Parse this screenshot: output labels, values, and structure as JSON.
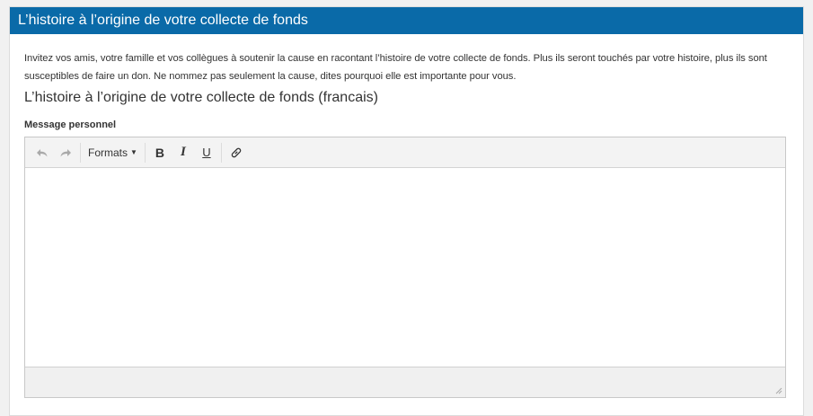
{
  "panel": {
    "title": "L’histoire à l’origine de votre collecte de fonds",
    "intro": "Invitez vos amis, votre famille et vos collègues à soutenir la cause en racontant l’histoire de votre collecte de fonds. Plus ils seront touchés par votre histoire, plus ils sont susceptibles de faire un don. Ne nommez pas seulement la cause, dites pourquoi elle est importante pour vous.",
    "section_title": "L’histoire à l’origine de votre collecte de fonds (francais)",
    "field_label": "Message personnel"
  },
  "editor": {
    "toolbar": {
      "undo_icon": "undo-icon",
      "redo_icon": "redo-icon",
      "formats_label": "Formats",
      "bold_label": "B",
      "italic_label": "I",
      "underline_label": "U",
      "link_icon": "link-icon"
    },
    "content": ""
  },
  "colors": {
    "header_bg": "#0a6aa8",
    "page_bg": "#f1f1f1",
    "toolbar_bg": "#f3f3f3"
  }
}
